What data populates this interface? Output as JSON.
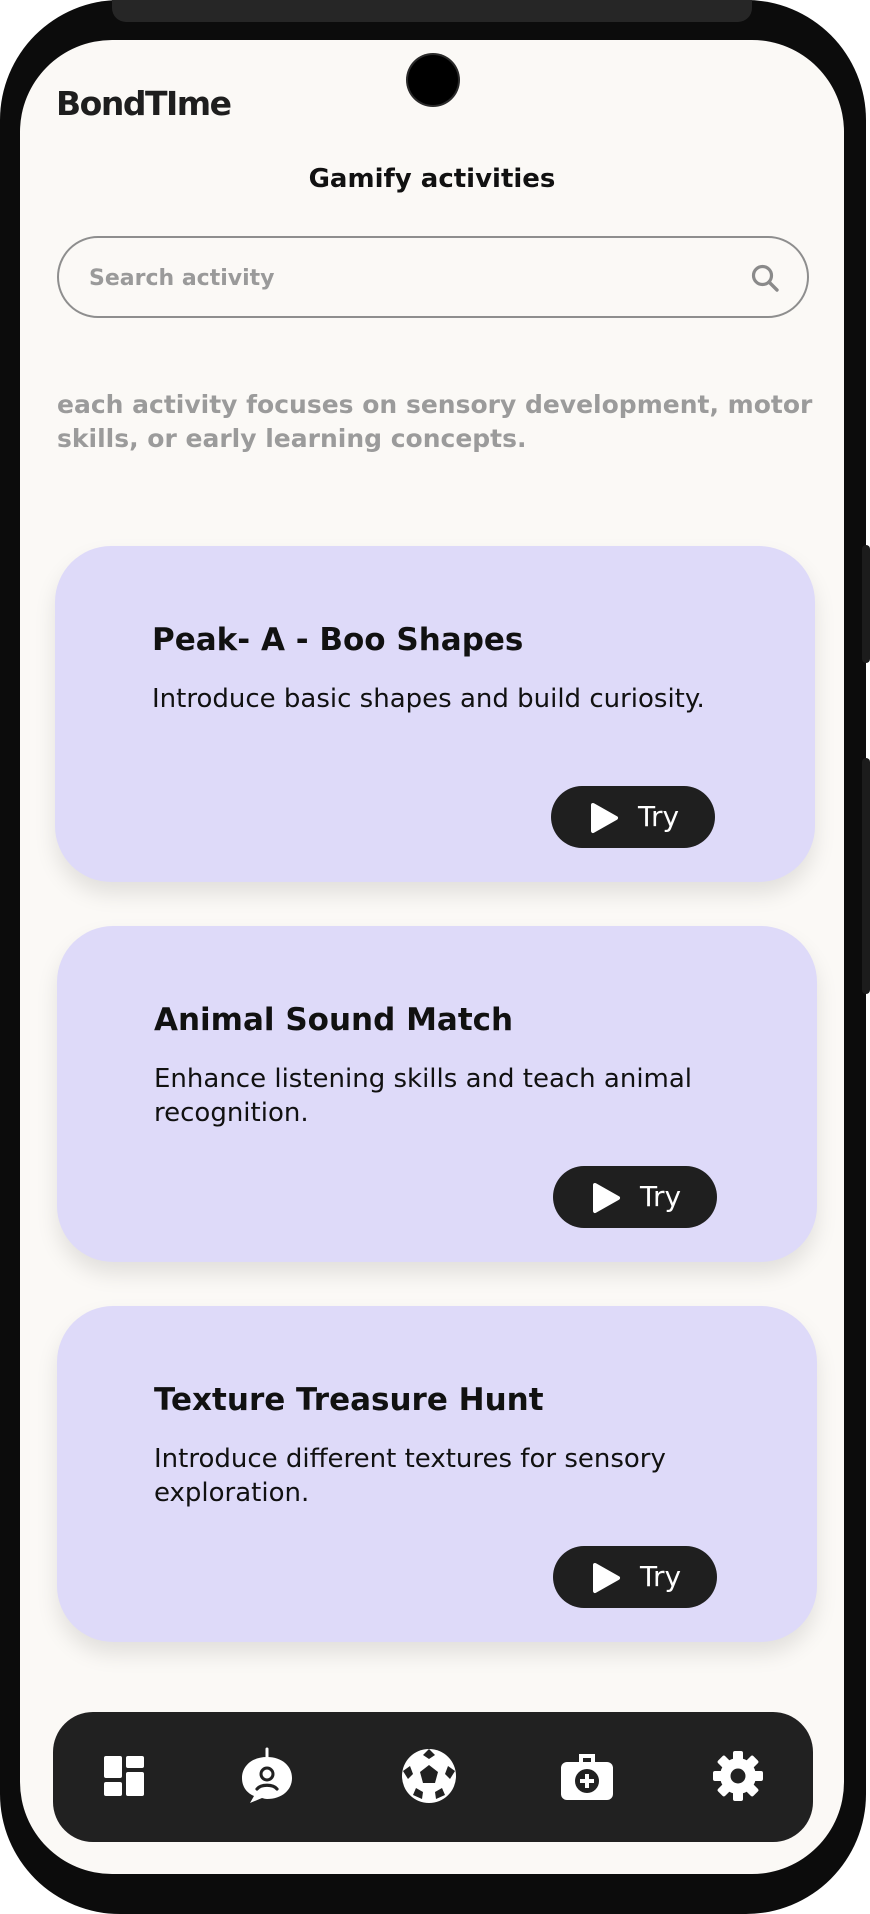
{
  "app": {
    "brand": "BondTIme",
    "title": "Gamify activities"
  },
  "search": {
    "placeholder": "Search activity",
    "icon": "search-icon"
  },
  "intro_text": "each activity focuses on sensory development, motor skills, or early learning concepts.",
  "cards": [
    {
      "title": "Peak- A - Boo Shapes",
      "description": "Introduce basic shapes and build curiosity.",
      "button_label": "Try",
      "button_icon": "play-icon"
    },
    {
      "title": "Animal Sound Match",
      "description": "Enhance listening skills and teach animal recognition.",
      "button_label": "Try",
      "button_icon": "play-icon"
    },
    {
      "title": "Texture Treasure Hunt",
      "description": "Introduce different textures for sensory exploration.",
      "button_label": "Try",
      "button_icon": "play-icon"
    }
  ],
  "bottom_nav": [
    {
      "icon": "dashboard-icon"
    },
    {
      "icon": "robot-chat-icon"
    },
    {
      "icon": "soccer-ball-icon"
    },
    {
      "icon": "medical-kit-icon"
    },
    {
      "icon": "settings-gear-icon"
    }
  ],
  "colors": {
    "background": "#fbf9f6",
    "card": "#dedaf9",
    "button": "#1f1f1f",
    "nav": "#212121",
    "muted_text": "#9b9b9b"
  }
}
